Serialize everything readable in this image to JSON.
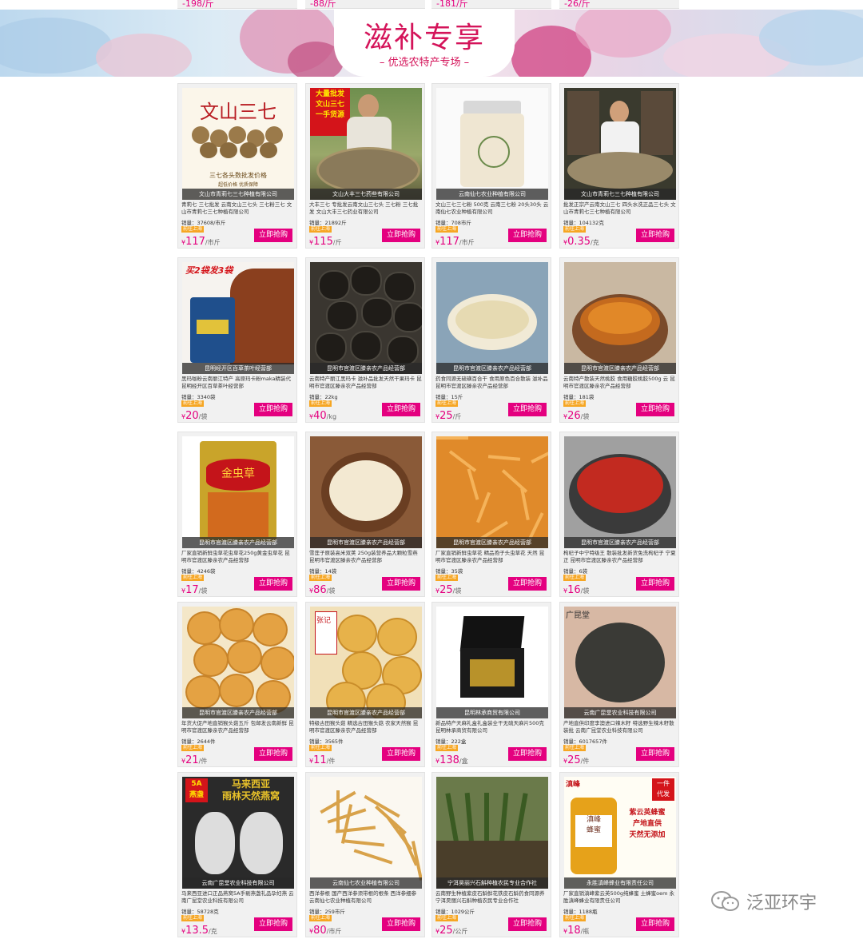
{
  "top_prices": [
    "-198/斤",
    "-88/斤",
    "-181/斤",
    "-26/斤"
  ],
  "banner": {
    "title": "滋补专享",
    "subtitle": "– 优选农特产专场 –"
  },
  "products": [
    {
      "shop": "文山市青莉七三七种植有限公司",
      "desc": "青莉七 三七批发 云南文山三七头 三七粉三七 文山市青莉七三七种植有限公司",
      "sales": "销量：37608/市斤",
      "tag": "前往上海",
      "price": "117",
      "unit": "/市斤",
      "buy": "立即抢购",
      "img": "sanqi"
    },
    {
      "shop": "文山大丰三七药些有限公司",
      "desc": "大丰三七 专批发云南文山三七头 三七粉 三七批发 文山大丰三七药业有限公司",
      "sales": "销量：21892斤",
      "tag": "前往上海",
      "price": "115",
      "unit": "/斤",
      "buy": "立即抢购",
      "img": "farmer"
    },
    {
      "shop": "云南仙七农业种植有限公司",
      "desc": "文山三七三七粉 500克 云南三七粉 20头30头 云南仙七农业种植有限公司",
      "sales": "销量：708市斤",
      "tag": "前往上海",
      "price": "117",
      "unit": "/市斤",
      "buy": "立即抢购",
      "img": "jar"
    },
    {
      "shop": "文山市青莉七三七种植有限公司",
      "desc": "批发正宗产云南文山三七 四头水洗正品三七头 文山市青莉七三七种植有限公司",
      "sales": "销量：104132克",
      "tag": "前往上海",
      "price": "0.35",
      "unit": "/克",
      "buy": "立即抢购",
      "img": "woman"
    },
    {
      "shop": "昆明经开区百草茶叶经营部",
      "desc": "黑玛咖粉云南丽江特产 高原玛卡粉maka精装代 昆明经开区百草茶叶经营部",
      "sales": "销量：3340袋",
      "tag": "前往上海",
      "price": "20",
      "unit": "/袋",
      "buy": "立即抢购",
      "img": "maca"
    },
    {
      "shop": "昆明市官渡区滕亲农产品经营部",
      "desc": "云南特产丽江黑玛卡 滋补品批发天然干果玛卡 昆明市官渡区滕亲农产品经营部",
      "sales": "销量：22kg",
      "tag": "前往上海",
      "price": "40",
      "unit": "/kg",
      "buy": "立即抢购",
      "img": "blackmaca"
    },
    {
      "shop": "昆明市官渡区滕亲农产品经营部",
      "desc": "药食同源无硫磺百合干 食用原色百合散装 滋补品 昆明市官渡区滕亲农产品经营部",
      "sales": "销量：15斤",
      "tag": "前往上海",
      "price": "25",
      "unit": "/斤",
      "buy": "立即抢购",
      "img": "lily"
    },
    {
      "shop": "昆明市官渡区滕亲农产品经营部",
      "desc": "云南特产散装天然桃胶 食用糖胶桃胶500g 云 昆明市官渡区滕亲农产品经营部",
      "sales": "销量：181袋",
      "tag": "前往上海",
      "price": "26",
      "unit": "/袋",
      "buy": "立即抢购",
      "img": "peachgum"
    },
    {
      "shop": "昆明市官渡区滕亲农产品经营部",
      "desc": "厂家直销新鲜虫草花虫草花250g黄金虫草花 昆明市官渡区滕亲农产品经营部",
      "sales": "销量：4246袋",
      "tag": "前往上海",
      "price": "17",
      "unit": "/袋",
      "buy": "立即抢购",
      "img": "bag"
    },
    {
      "shop": "昆明市官渡区滕亲农产品经营部",
      "desc": "雪莲子原装高米双荚 250g装营养品大颗粒雪燕 昆明市官渡区滕亲农产品经营部",
      "sales": "销量：14袋",
      "tag": "前往上海",
      "price": "86",
      "unit": "/袋",
      "buy": "立即抢购",
      "img": "seeds"
    },
    {
      "shop": "昆明市官渡区滕亲农产品经营部",
      "desc": "厂家直销新鲜虫草花 精品孢子头虫草花 天然 昆明市官渡区滕亲农产品经营部",
      "sales": "销量：35袋",
      "tag": "前往上海",
      "price": "25",
      "unit": "/袋",
      "buy": "立即抢购",
      "img": "cordyceps"
    },
    {
      "shop": "昆明市官渡区滕亲农产品经营部",
      "desc": "枸杞子中宁特级王 散装批发新货免洗枸杞子 宁夏正 昆明市官渡区滕亲农产品经营部",
      "sales": "销量：6袋",
      "tag": "前往上海",
      "price": "16",
      "unit": "/袋",
      "buy": "立即抢购",
      "img": "goji"
    },
    {
      "shop": "昆明市官渡区滕亲农产品经营部",
      "desc": "年货大促产地直销猴头菇五斤 包邮发云南新鲜 昆明市官渡区滕亲农产品经营部",
      "sales": "销量：2644件",
      "tag": "前往上海",
      "price": "21",
      "unit": "/件",
      "buy": "立即抢购",
      "img": "mushroom"
    },
    {
      "shop": "昆明市官渡区滕亲农产品经营部",
      "desc": "特级古田猴头菇 精选古田猴头菇 农家天然猴 昆明市官渡区滕亲农产品经营部",
      "sales": "销量：3565件",
      "tag": "前往上海",
      "price": "11",
      "unit": "/件",
      "buy": "立即抢购",
      "img": "mushroom2"
    },
    {
      "shop": "昆明林承商贸有限公司",
      "desc": "新品特产天麻礼盒礼盒装全干无硫天麻片500克 昆明林承商贸有限公司",
      "sales": "销量：222盒",
      "tag": "前往上海",
      "price": "138",
      "unit": "/盒",
      "buy": "立即抢购",
      "img": "giftbox"
    },
    {
      "shop": "云南广昆堂农业科技有限公司",
      "desc": "产地直供印度李澳进口辣木籽 特选野生辣木籽散装批 云南广昆堂农业科技有限公司",
      "sales": "销量：6017657件",
      "tag": "前往上海",
      "price": "25",
      "unit": "/件",
      "buy": "立即抢购",
      "img": "hands"
    },
    {
      "shop": "云南广昆堂农业科技有限公司",
      "desc": "马来西亚进口正品燕窝5A手剔燕盏礼品孕妇燕 云南广昆堂农业科技有限公司",
      "sales": "销量：58728克",
      "tag": "前往上海",
      "price": "13.5",
      "unit": "/克",
      "buy": "立即抢购",
      "img": "nest"
    },
    {
      "shop": "云南仙七农业种植有限公司",
      "desc": "西洋参根 国产西洋参须带根的根条 西洋参细参 云南仙七农业种植有限公司",
      "sales": "销量：259市斤",
      "tag": "前往上海",
      "price": "80",
      "unit": "/市斤",
      "buy": "立即抢购",
      "img": "roots"
    },
    {
      "shop": "宁洱昊丽兴石斛种植农民专业合作社",
      "desc": "云南野生种植紫皮石斛鲜花铁皮石斛药食同源养 宁洱昊丽兴石斛种植农民专业合作社",
      "sales": "销量：1029公斤",
      "tag": "前往上海",
      "price": "25",
      "unit": "/公斤",
      "buy": "立即抢购",
      "img": "orchid"
    },
    {
      "shop": "永胜滇峰蜂业有限责任公司",
      "desc": "厂家直销滇峰紫云英500g纯蜂蜜 土蜂蜜oem 永胜滇峰蜂业有限责任公司",
      "sales": "销量：1188瓶",
      "tag": "前往上海",
      "price": "18",
      "unit": "/瓶",
      "buy": "立即抢购",
      "img": "honey"
    }
  ],
  "overlay_text": {
    "sanqi_title": "文山三七",
    "sanqi_sub": "三七各头数批发价格",
    "sanqi_sub2": "超低价格 优质保障",
    "farmer_banner": "大量批发\n文山三七\n一手货源",
    "maca_promo": "买2袋发3袋",
    "bag_label": "金虫草",
    "mushroom2_label": "张记",
    "hands_label": "广昆堂",
    "nest_badge": "5A\n燕盏",
    "nest_title": "马来西亚\n雨林天然燕窝",
    "honey_badge": "一件\n代发",
    "honey_brand": "滇峰",
    "honey_title": "紫云英蜂蜜\n产地直供\n天然无添加",
    "honey_jar": "滇峰\n蜂蜜"
  },
  "watermark": "泛亚环宇",
  "colors": {
    "accent": "#e4007f",
    "banner_text": "#d4145a"
  }
}
